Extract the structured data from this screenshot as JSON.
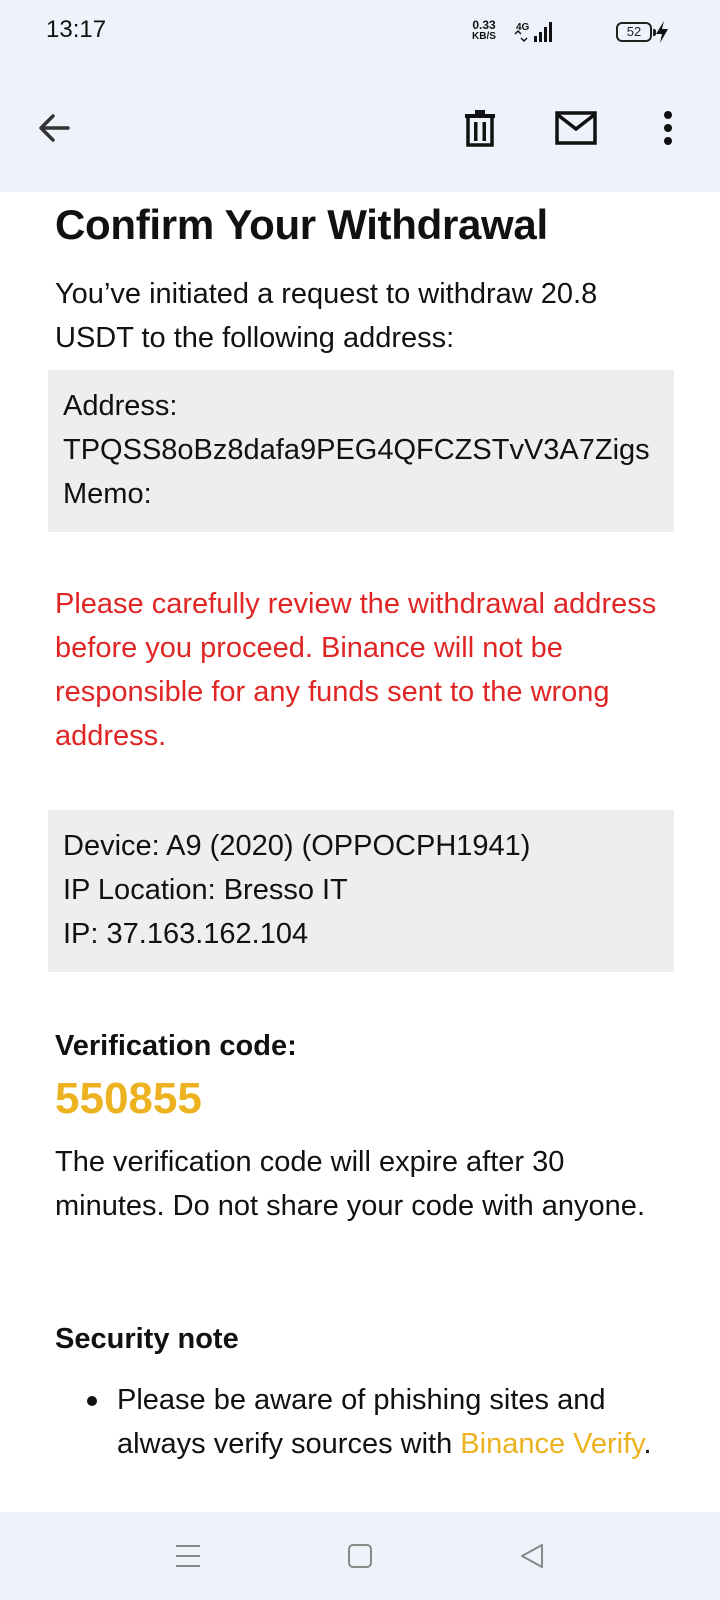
{
  "status_bar": {
    "time": "13:17",
    "net_speed_value": "0.33",
    "net_speed_unit": "KB/S",
    "network": "4G",
    "battery": "52"
  },
  "toolbar": {
    "icons": [
      "back-arrow-icon",
      "trash-icon",
      "mail-icon",
      "more-vert-icon"
    ]
  },
  "email": {
    "title": "Confirm Your Withdrawal",
    "intro": "You’ve initiated a request to withdraw 20.8 USDT to the following address:",
    "address_label": "Address:",
    "address_value": "TPQSS8oBz8dafa9PEG4QFCZSTvV3A7Zigs",
    "memo_label": "Memo:",
    "warning": "Please carefully review the withdrawal address before you proceed. Binance will not be responsible for any funds sent to the wrong address.",
    "device": "Device: A9 (2020) (OPPOCPH1941)",
    "ip_location": "IP Location: Bresso IT",
    "ip": "IP: 37.163.162.104",
    "verification_label": "Verification code:",
    "verification_code": "550855",
    "expire_note": "The verification code will expire after 30 minutes. Do not share your code with anyone.",
    "security_note_title": "Security note",
    "bullet_text": "Please be aware of phishing sites and always verify sources with ",
    "bullet_link": "Binance Verify",
    "bullet_end": "."
  },
  "colors": {
    "accent_yellow": "#ecb21f",
    "warning_red": "#e02525",
    "chrome_bg": "#eef2fa",
    "box_bg": "#eeeeee"
  },
  "nav_bar": {
    "icons": [
      "menu-icon",
      "home-square-icon",
      "back-triangle-icon"
    ]
  }
}
